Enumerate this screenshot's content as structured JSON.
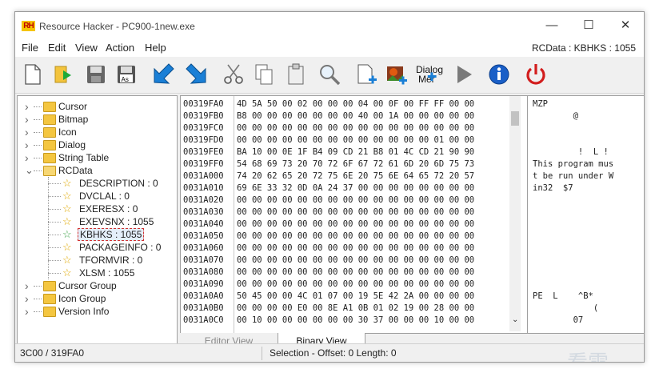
{
  "window": {
    "title": "Resource Hacker - PC900-1new.exe",
    "app_icon_text": "RH",
    "minimize_glyph": "—",
    "maximize_glyph": "☐",
    "close_glyph": "✕"
  },
  "menu": {
    "items": [
      "File",
      "Edit",
      "View",
      "Action",
      "Help"
    ],
    "current_resource": "RCData : KBHKS : 1055"
  },
  "toolbar": {
    "dialog_menu_label_1": "Dialog",
    "dialog_menu_label_2": "Mer"
  },
  "tree": {
    "items": [
      {
        "label": "Cursor",
        "level": 0,
        "kind": "folder",
        "expander": ">"
      },
      {
        "label": "Bitmap",
        "level": 0,
        "kind": "folder",
        "expander": ">"
      },
      {
        "label": "Icon",
        "level": 0,
        "kind": "folder",
        "expander": ">"
      },
      {
        "label": "Dialog",
        "level": 0,
        "kind": "folder",
        "expander": ">"
      },
      {
        "label": "String Table",
        "level": 0,
        "kind": "folder",
        "expander": ">"
      },
      {
        "label": "RCData",
        "level": 0,
        "kind": "folder-open",
        "expander": "v"
      },
      {
        "label": "DESCRIPTION : 0",
        "level": 1,
        "kind": "star"
      },
      {
        "label": "DVCLAL : 0",
        "level": 1,
        "kind": "star"
      },
      {
        "label": "EXERESX : 0",
        "level": 1,
        "kind": "star"
      },
      {
        "label": "EXEVSNX : 1055",
        "level": 1,
        "kind": "star"
      },
      {
        "label": "KBHKS : 1055",
        "level": 1,
        "kind": "star-selected"
      },
      {
        "label": "PACKAGEINFO : 0",
        "level": 1,
        "kind": "star"
      },
      {
        "label": "TFORMVIR : 0",
        "level": 1,
        "kind": "star"
      },
      {
        "label": "XLSM : 1055",
        "level": 1,
        "kind": "star"
      },
      {
        "label": "Cursor Group",
        "level": 0,
        "kind": "folder",
        "expander": ">"
      },
      {
        "label": "Icon Group",
        "level": 0,
        "kind": "folder",
        "expander": ">"
      },
      {
        "label": "Version Info",
        "level": 0,
        "kind": "folder",
        "expander": ">"
      }
    ]
  },
  "hex": {
    "rows": [
      {
        "addr": "00319FA0",
        "bytes": "4D 5A 50 00 02 00 00 00 04 00 0F 00 FF FF 00 00",
        "ascii": "MZP"
      },
      {
        "addr": "00319FB0",
        "bytes": "B8 00 00 00 00 00 00 00 40 00 1A 00 00 00 00 00",
        "ascii": "        @"
      },
      {
        "addr": "00319FC0",
        "bytes": "00 00 00 00 00 00 00 00 00 00 00 00 00 00 00 00",
        "ascii": ""
      },
      {
        "addr": "00319FD0",
        "bytes": "00 00 00 00 00 00 00 00 00 00 00 00 00 01 00 00",
        "ascii": ""
      },
      {
        "addr": "00319FE0",
        "bytes": "BA 10 00 0E 1F B4 09 CD 21 B8 01 4C CD 21 90 90",
        "ascii": "         !  L !"
      },
      {
        "addr": "00319FF0",
        "bytes": "54 68 69 73 20 70 72 6F 67 72 61 6D 20 6D 75 73",
        "ascii": "This program mus"
      },
      {
        "addr": "0031A000",
        "bytes": "74 20 62 65 20 72 75 6E 20 75 6E 64 65 72 20 57",
        "ascii": "t be run under W"
      },
      {
        "addr": "0031A010",
        "bytes": "69 6E 33 32 0D 0A 24 37 00 00 00 00 00 00 00 00",
        "ascii": "in32  $7"
      },
      {
        "addr": "0031A020",
        "bytes": "00 00 00 00 00 00 00 00 00 00 00 00 00 00 00 00",
        "ascii": ""
      },
      {
        "addr": "0031A030",
        "bytes": "00 00 00 00 00 00 00 00 00 00 00 00 00 00 00 00",
        "ascii": ""
      },
      {
        "addr": "0031A040",
        "bytes": "00 00 00 00 00 00 00 00 00 00 00 00 00 00 00 00",
        "ascii": ""
      },
      {
        "addr": "0031A050",
        "bytes": "00 00 00 00 00 00 00 00 00 00 00 00 00 00 00 00",
        "ascii": ""
      },
      {
        "addr": "0031A060",
        "bytes": "00 00 00 00 00 00 00 00 00 00 00 00 00 00 00 00",
        "ascii": ""
      },
      {
        "addr": "0031A070",
        "bytes": "00 00 00 00 00 00 00 00 00 00 00 00 00 00 00 00",
        "ascii": ""
      },
      {
        "addr": "0031A080",
        "bytes": "00 00 00 00 00 00 00 00 00 00 00 00 00 00 00 00",
        "ascii": ""
      },
      {
        "addr": "0031A090",
        "bytes": "00 00 00 00 00 00 00 00 00 00 00 00 00 00 00 00",
        "ascii": ""
      },
      {
        "addr": "0031A0A0",
        "bytes": "50 45 00 00 4C 01 07 00 19 5E 42 2A 00 00 00 00",
        "ascii": "PE  L    ^B*"
      },
      {
        "addr": "0031A0B0",
        "bytes": "00 00 00 00 E0 00 8E A1 0B 01 02 19 00 28 00 00",
        "ascii": "            ("
      },
      {
        "addr": "0031A0C0",
        "bytes": "00 10 00 00 00 00 00 00 30 37 00 00 00 10 00 00",
        "ascii": "        07"
      }
    ]
  },
  "tabs": {
    "editor_view": "Editor View",
    "binary_view": "Binary View"
  },
  "status": {
    "position": "3C00 / 319FA0",
    "selection": "Selection - Offset: 0 Length: 0"
  },
  "watermark": "看雪",
  "icons": [
    "new-file-icon",
    "open-file-icon",
    "save-icon",
    "save-as-icon",
    "arrow-left-icon",
    "arrow-right-icon",
    "cut-icon",
    "copy-icon",
    "paste-icon",
    "search-icon",
    "add-blank-resource-icon",
    "add-image-resource-icon",
    "dialog-merger-icon",
    "compile-run-icon",
    "info-icon",
    "power-icon"
  ]
}
